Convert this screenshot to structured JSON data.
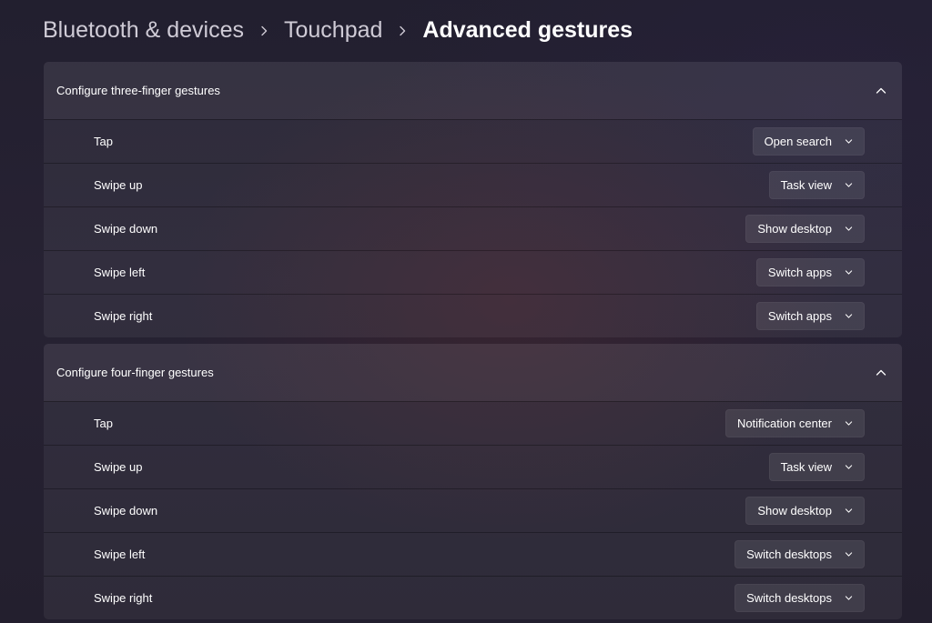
{
  "breadcrumb": {
    "items": [
      "Bluetooth & devices",
      "Touchpad"
    ],
    "current": "Advanced gestures"
  },
  "icons": {
    "separator": "chevron-right-icon",
    "collapse": "chevron-up-icon",
    "dropdown": "chevron-down-icon"
  },
  "groups": [
    {
      "title": "Configure three-finger gestures",
      "rows": [
        {
          "label": "Tap",
          "value": "Open search"
        },
        {
          "label": "Swipe up",
          "value": "Task view"
        },
        {
          "label": "Swipe down",
          "value": "Show desktop"
        },
        {
          "label": "Swipe left",
          "value": "Switch apps"
        },
        {
          "label": "Swipe right",
          "value": "Switch apps"
        }
      ]
    },
    {
      "title": "Configure four-finger gestures",
      "rows": [
        {
          "label": "Tap",
          "value": "Notification center"
        },
        {
          "label": "Swipe up",
          "value": "Task view"
        },
        {
          "label": "Swipe down",
          "value": "Show desktop"
        },
        {
          "label": "Swipe left",
          "value": "Switch desktops"
        },
        {
          "label": "Swipe right",
          "value": "Switch desktops"
        }
      ]
    }
  ]
}
